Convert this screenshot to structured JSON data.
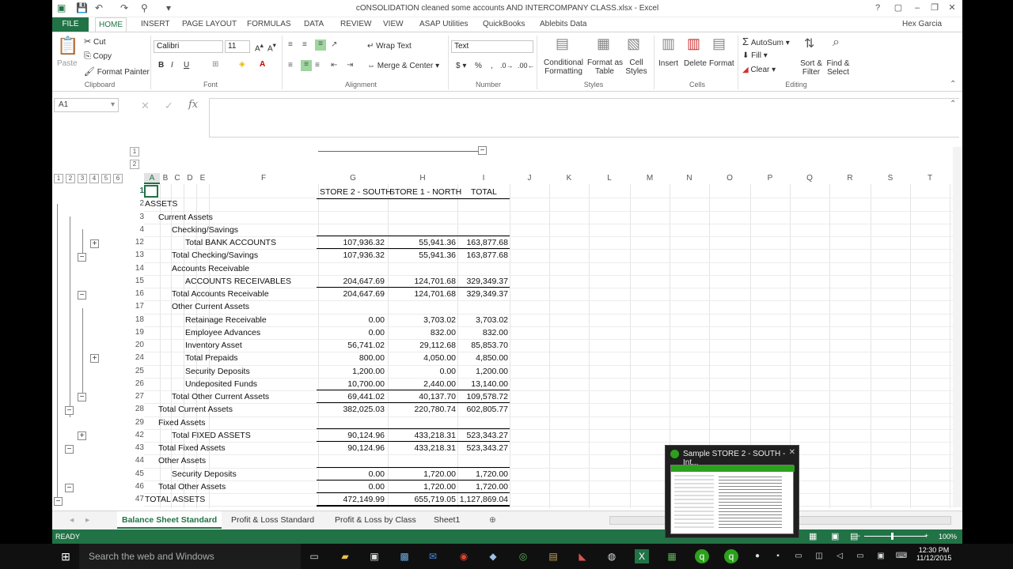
{
  "window": {
    "title": "cONSOLIDATION cleaned some accounts AND INTERCOMPANY CLASS.xlsx - Excel",
    "user": "Hex Garcia"
  },
  "ribbon_tabs": [
    "FILE",
    "HOME",
    "INSERT",
    "PAGE LAYOUT",
    "FORMULAS",
    "DATA",
    "REVIEW",
    "VIEW",
    "ASAP Utilities",
    "QuickBooks",
    "Ablebits Data"
  ],
  "ribbon": {
    "clipboard": {
      "paste": "Paste",
      "cut": "Cut",
      "copy": "Copy",
      "format_painter": "Format Painter",
      "group": "Clipboard"
    },
    "font": {
      "name": "Calibri",
      "size": "11",
      "group": "Font"
    },
    "alignment": {
      "wrap": "Wrap Text",
      "merge": "Merge & Center",
      "group": "Alignment"
    },
    "number": {
      "format": "Text",
      "group": "Number"
    },
    "styles": {
      "conditional": "Conditional",
      "conditional2": "Formatting",
      "format_as": "Format as",
      "format_as2": "Table",
      "cell": "Cell",
      "cell2": "Styles",
      "group": "Styles"
    },
    "cells": {
      "insert": "Insert",
      "delete": "Delete",
      "format": "Format",
      "group": "Cells"
    },
    "editing": {
      "autosum": "AutoSum",
      "fill": "Fill",
      "clear": "Clear",
      "sort": "Sort &",
      "sort2": "Filter",
      "find": "Find &",
      "find2": "Select",
      "group": "Editing"
    }
  },
  "formula_bar": {
    "name_box": "A1",
    "fx": "fx",
    "value": ""
  },
  "outline_levels": [
    "1",
    "2",
    "3",
    "4",
    "5",
    "6"
  ],
  "column_outline_levels": [
    "1",
    "2"
  ],
  "columns": [
    "A",
    "B",
    "C",
    "D",
    "E",
    "F",
    "G",
    "H",
    "I",
    "J",
    "K",
    "L",
    "M",
    "N",
    "O",
    "P",
    "Q",
    "R",
    "S",
    "T"
  ],
  "table": {
    "headers": {
      "g": "STORE 2 - SOUTH",
      "h": "STORE 1 - NORTH",
      "i": "TOTAL"
    },
    "rows": [
      {
        "row": "1",
        "label": "",
        "indent": 0,
        "g": "",
        "h": "",
        "i": ""
      },
      {
        "row": "2",
        "label": "ASSETS",
        "indent": 0,
        "g": "",
        "h": "",
        "i": ""
      },
      {
        "row": "3",
        "label": "Current Assets",
        "indent": 1,
        "g": "",
        "h": "",
        "i": ""
      },
      {
        "row": "4",
        "label": "Checking/Savings",
        "indent": 2,
        "g": "",
        "h": "",
        "i": ""
      },
      {
        "row": "12",
        "label": "Total BANK ACCOUNTS",
        "indent": 3,
        "g": "107,936.32",
        "h": "55,941.36",
        "i": "163,877.68"
      },
      {
        "row": "13",
        "label": "Total Checking/Savings",
        "indent": 2,
        "g": "107,936.32",
        "h": "55,941.36",
        "i": "163,877.68"
      },
      {
        "row": "14",
        "label": "Accounts Receivable",
        "indent": 2,
        "g": "",
        "h": "",
        "i": ""
      },
      {
        "row": "15",
        "label": "ACCOUNTS RECEIVABLES",
        "indent": 3,
        "g": "204,647.69",
        "h": "124,701.68",
        "i": "329,349.37"
      },
      {
        "row": "16",
        "label": "Total Accounts Receivable",
        "indent": 2,
        "g": "204,647.69",
        "h": "124,701.68",
        "i": "329,349.37"
      },
      {
        "row": "17",
        "label": "Other Current Assets",
        "indent": 2,
        "g": "",
        "h": "",
        "i": ""
      },
      {
        "row": "18",
        "label": "Retainage Receivable",
        "indent": 3,
        "g": "0.00",
        "h": "3,703.02",
        "i": "3,703.02"
      },
      {
        "row": "19",
        "label": "Employee Advances",
        "indent": 3,
        "g": "0.00",
        "h": "832.00",
        "i": "832.00"
      },
      {
        "row": "20",
        "label": "Inventory Asset",
        "indent": 3,
        "g": "56,741.02",
        "h": "29,112.68",
        "i": "85,853.70"
      },
      {
        "row": "24",
        "label": "Total Prepaids",
        "indent": 3,
        "g": "800.00",
        "h": "4,050.00",
        "i": "4,850.00"
      },
      {
        "row": "25",
        "label": "Security Deposits",
        "indent": 3,
        "g": "1,200.00",
        "h": "0.00",
        "i": "1,200.00"
      },
      {
        "row": "26",
        "label": "Undeposited Funds",
        "indent": 3,
        "g": "10,700.00",
        "h": "2,440.00",
        "i": "13,140.00"
      },
      {
        "row": "27",
        "label": "Total Other Current Assets",
        "indent": 2,
        "g": "69,441.02",
        "h": "40,137.70",
        "i": "109,578.72"
      },
      {
        "row": "28",
        "label": "Total Current Assets",
        "indent": 1,
        "g": "382,025.03",
        "h": "220,780.74",
        "i": "602,805.77"
      },
      {
        "row": "29",
        "label": "Fixed Assets",
        "indent": 1,
        "g": "",
        "h": "",
        "i": ""
      },
      {
        "row": "42",
        "label": "Total FIXED ASSETS",
        "indent": 2,
        "g": "90,124.96",
        "h": "433,218.31",
        "i": "523,343.27"
      },
      {
        "row": "43",
        "label": "Total Fixed Assets",
        "indent": 1,
        "g": "90,124.96",
        "h": "433,218.31",
        "i": "523,343.27"
      },
      {
        "row": "44",
        "label": "Other Assets",
        "indent": 1,
        "g": "",
        "h": "",
        "i": ""
      },
      {
        "row": "45",
        "label": "Security Deposits",
        "indent": 2,
        "g": "0.00",
        "h": "1,720.00",
        "i": "1,720.00"
      },
      {
        "row": "46",
        "label": "Total Other Assets",
        "indent": 1,
        "g": "0.00",
        "h": "1,720.00",
        "i": "1,720.00"
      },
      {
        "row": "47",
        "label": "TOTAL ASSETS",
        "indent": 0,
        "g": "472,149.99",
        "h": "655,719.05",
        "i": "1,127,869.04"
      }
    ]
  },
  "sheet_tabs": [
    "Balance Sheet Standard",
    "Profit & Loss Standard",
    "Profit & Loss by Class",
    "Sheet1"
  ],
  "status": {
    "ready": "READY",
    "zoom": "100%"
  },
  "preview": {
    "title": "Sample STORE 2 - SOUTH - Int..."
  },
  "taskbar": {
    "search": "Search the web and Windows",
    "time": "12:30 PM",
    "date": "11/12/2015"
  }
}
